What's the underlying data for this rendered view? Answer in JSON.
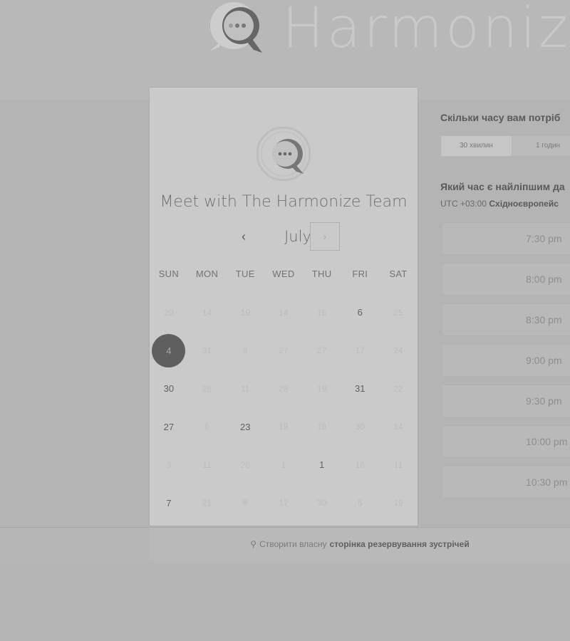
{
  "brand": {
    "name": "Harmoniz"
  },
  "calendar": {
    "host_title": "Meet with The Harmonize Team",
    "month": "July",
    "prev_glyph": "‹",
    "next_glyph": "›",
    "weekdays": [
      "SUN",
      "MON",
      "TUE",
      "WED",
      "THU",
      "FRI",
      "SAT"
    ],
    "weeks": [
      [
        {
          "d": "20",
          "a": false
        },
        {
          "d": "14",
          "a": false
        },
        {
          "d": "19",
          "a": false
        },
        {
          "d": "14",
          "a": false
        },
        {
          "d": "15",
          "a": false
        },
        {
          "d": "6",
          "a": true
        },
        {
          "d": "25",
          "a": false
        }
      ],
      [
        {
          "d": "4",
          "a": true,
          "selected": true
        },
        {
          "d": "31",
          "a": false
        },
        {
          "d": "6",
          "a": false
        },
        {
          "d": "27",
          "a": false
        },
        {
          "d": "27",
          "a": false
        },
        {
          "d": "17",
          "a": false
        },
        {
          "d": "24",
          "a": false
        }
      ],
      [
        {
          "d": "30",
          "a": true
        },
        {
          "d": "28",
          "a": false
        },
        {
          "d": "11",
          "a": false
        },
        {
          "d": "28",
          "a": false
        },
        {
          "d": "19",
          "a": false
        },
        {
          "d": "31",
          "a": true
        },
        {
          "d": "22",
          "a": false
        }
      ],
      [
        {
          "d": "27",
          "a": true
        },
        {
          "d": "6",
          "a": false
        },
        {
          "d": "23",
          "a": true
        },
        {
          "d": "19",
          "a": false
        },
        {
          "d": "18",
          "a": false
        },
        {
          "d": "30",
          "a": false
        },
        {
          "d": "14",
          "a": false
        }
      ],
      [
        {
          "d": "3",
          "a": false
        },
        {
          "d": "11",
          "a": false
        },
        {
          "d": "28",
          "a": false
        },
        {
          "d": "1",
          "a": false
        },
        {
          "d": "1",
          "a": true
        },
        {
          "d": "16",
          "a": false
        },
        {
          "d": "11",
          "a": false
        }
      ],
      [
        {
          "d": "7",
          "a": true
        },
        {
          "d": "21",
          "a": false
        },
        {
          "d": "8",
          "a": false
        },
        {
          "d": "17",
          "a": false
        },
        {
          "d": "30",
          "a": false
        },
        {
          "d": "5",
          "a": false
        },
        {
          "d": "19",
          "a": false
        }
      ]
    ]
  },
  "booking": {
    "duration_heading": "Скільки часу вам потріб",
    "durations": [
      "30 хвилин",
      "1 годин"
    ],
    "time_heading": "Який час є найліпшим да",
    "tz_offset": "UTC +03:00",
    "tz_name": "Східноєвропейс",
    "slots": [
      "7:30 pm",
      "8:00 pm",
      "8:30 pm",
      "9:00 pm",
      "9:30 pm",
      "10:00 pm",
      "10:30 pm"
    ]
  },
  "footer": {
    "text_regular": "Створити власну",
    "text_bold": "сторінка резервування зустрічей"
  }
}
